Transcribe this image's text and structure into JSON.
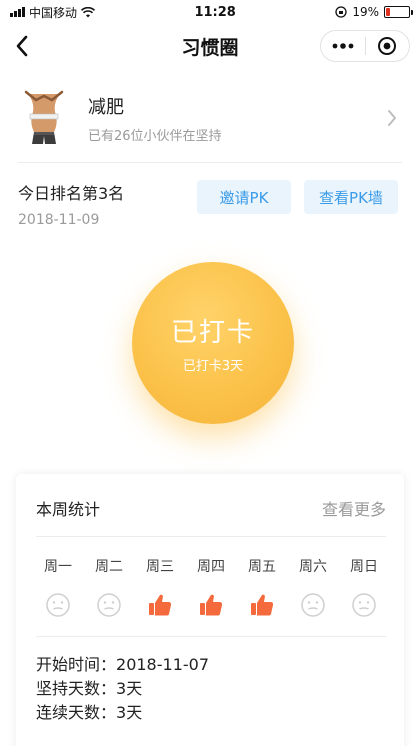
{
  "status_bar": {
    "carrier": "中国移动",
    "time": "11:28",
    "battery": "19%",
    "battery_level": 0.19,
    "battery_color": "#e0301e"
  },
  "nav": {
    "title": "习惯圈",
    "back_icon": "chevron-left-icon",
    "more_icon": "more-dots-icon",
    "close_icon": "target-circle-icon"
  },
  "habit": {
    "title": "减肥",
    "subtitle": "已有26位小伙伴在坚持",
    "icon": "waist-measure-icon"
  },
  "ranking": {
    "title": "今日排名第3名",
    "date": "2018-11-09",
    "invite_label": "邀请PK",
    "view_wall_label": "查看PK墙",
    "pill_color": "#3a9be8"
  },
  "checkin": {
    "main": "已打卡",
    "sub": "已打卡3天",
    "color": "#fbc24a"
  },
  "weekly": {
    "title": "本周统计",
    "more_label": "查看更多",
    "days": [
      {
        "label": "周一",
        "status": "missed"
      },
      {
        "label": "周二",
        "status": "missed"
      },
      {
        "label": "周三",
        "status": "done"
      },
      {
        "label": "周四",
        "status": "done"
      },
      {
        "label": "周五",
        "status": "done"
      },
      {
        "label": "周六",
        "status": "missed"
      },
      {
        "label": "周日",
        "status": "missed"
      }
    ],
    "done_color": "#f46a3c",
    "missed_color": "#cfcfcf",
    "stats": {
      "start_label": "开始时间：",
      "start_value": "2018-11-07",
      "persist_label": "坚持天数：",
      "persist_value": "3天",
      "streak_label": "连续天数：",
      "streak_value": "3天"
    }
  }
}
